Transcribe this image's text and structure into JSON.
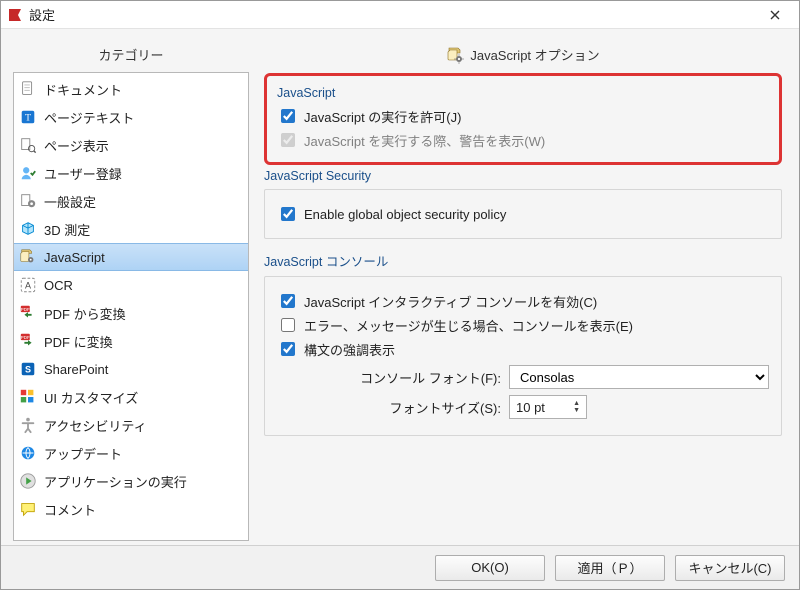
{
  "titlebar": {
    "title": "設定"
  },
  "left": {
    "header": "カテゴリー",
    "selected": "JavaScript",
    "items": [
      "ドキュメント",
      "ページテキスト",
      "ページ表示",
      "ユーザー登録",
      "一般設定",
      "3D 測定",
      "JavaScript",
      "OCR",
      "PDF から変換",
      "PDF に変換",
      "SharePoint",
      "UI カスタマイズ",
      "アクセシビリティ",
      "アップデート",
      "アプリケーションの実行",
      "コメント"
    ]
  },
  "right": {
    "header": "JavaScript オプション",
    "js": {
      "title": "JavaScript",
      "enable": {
        "label": "JavaScript の実行を許可(J)",
        "checked": true,
        "disabled": false
      },
      "warn": {
        "label": "JavaScript を実行する際、警告を表示(W)",
        "checked": true,
        "disabled": true
      }
    },
    "security": {
      "title": "JavaScript Security",
      "policy": {
        "label": "Enable global object security policy",
        "checked": true
      }
    },
    "console": {
      "title": "JavaScript コンソール",
      "interactive": {
        "label": "JavaScript インタラクティブ コンソールを有効(C)",
        "checked": true
      },
      "errors": {
        "label": "エラー、メッセージが生じる場合、コンソールを表示(E)",
        "checked": false
      },
      "syntax": {
        "label": "構文の強調表示",
        "checked": true
      },
      "font_label": "コンソール フォント(F):",
      "font_value": "Consolas",
      "size_label": "フォントサイズ(S):",
      "size_value": "10 pt"
    }
  },
  "footer": {
    "ok": "OK(O)",
    "apply": "適用（Ｐ）",
    "cancel": "キャンセル(C)"
  }
}
